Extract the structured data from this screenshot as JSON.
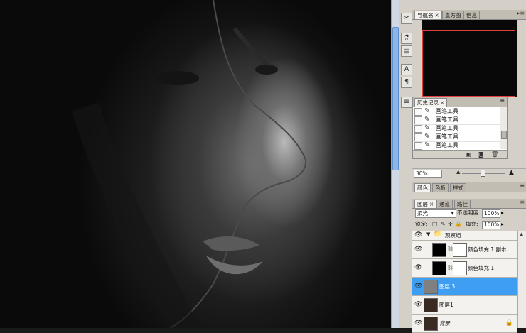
{
  "navigator": {
    "tabs": [
      "导航器",
      "直方图",
      "信息"
    ],
    "zoom": "30%"
  },
  "history": {
    "tab": "历史记录",
    "items": [
      "画笔工具",
      "画笔工具",
      "画笔工具",
      "画笔工具",
      "画笔工具"
    ]
  },
  "color_panel": {
    "tabs": [
      "颜色",
      "色板",
      "样式"
    ]
  },
  "layers": {
    "tabs": [
      "图层",
      "通道",
      "路径"
    ],
    "blend_mode": "柔光",
    "opacity_label": "不透明度:",
    "opacity": "100%",
    "lock_label": "锁定:",
    "fill_label": "填充:",
    "fill": "100%",
    "items": [
      {
        "name": "观察组",
        "type": "group"
      },
      {
        "name": "颜色填充 1 副本",
        "type": "fill"
      },
      {
        "name": "颜色填充 1",
        "type": "fill"
      },
      {
        "name": "图层 3",
        "type": "pixel",
        "selected": true
      },
      {
        "name": "图层1",
        "type": "pixel"
      },
      {
        "name": "背景",
        "type": "background"
      }
    ]
  },
  "colors": {
    "selection": "#3d9ef2",
    "nav_view_box": "#e04040"
  }
}
